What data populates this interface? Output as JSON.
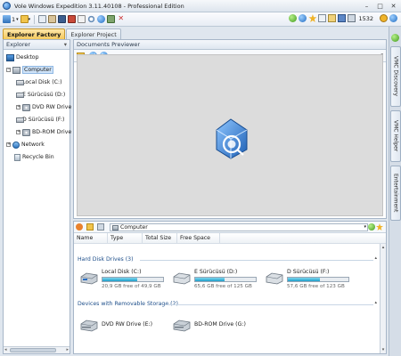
{
  "window": {
    "title": "Vole Windows Expedition  3.11.40108 - Professional Edition"
  },
  "toolbar": {
    "version_badge": "1",
    "counter": "1532"
  },
  "tabs": [
    {
      "label": "Explorer Factory",
      "active": true
    },
    {
      "label": "Explorer Project",
      "active": false
    }
  ],
  "explorer": {
    "title": "Explorer",
    "tree": [
      {
        "label": "Desktop",
        "icon": "desktop-icon"
      },
      {
        "label": "Computer",
        "icon": "computer-icon"
      },
      {
        "label": "Local Disk (C:)",
        "icon": "drive-icon"
      },
      {
        "label": "E Sürücüsü (D:)",
        "icon": "drive-icon"
      },
      {
        "label": "DVD RW Drive (E:)",
        "icon": "dvd-icon"
      },
      {
        "label": "D Sürücüsü (F:)",
        "icon": "drive-icon"
      },
      {
        "label": "BD-ROM Drive (G:)",
        "icon": "dvd-icon"
      },
      {
        "label": "Network",
        "icon": "network-icon"
      },
      {
        "label": "Recycle Bin",
        "icon": "recycle-bin-icon"
      }
    ]
  },
  "previewer": {
    "title": "Documents Previewer"
  },
  "browser": {
    "address": "Computer",
    "columns": [
      "Name",
      "Type",
      "Total Size",
      "Free Space"
    ],
    "hard_disk_group": "Hard Disk Drives (3)",
    "hard_disks": [
      {
        "name": "Local Disk (C:)",
        "free": "20,9 GB free of 49,9 GB",
        "used_fraction": 0.58
      },
      {
        "name": "E Sürücüsü (D:)",
        "free": "65,6 GB free of 125 GB",
        "used_fraction": 0.48
      },
      {
        "name": "D Sürücüsü (F:)",
        "free": "57,6 GB free of 123 GB",
        "used_fraction": 0.53
      }
    ],
    "removable_group": "Devices with Removable Storage (2)",
    "removable": [
      {
        "name": "DVD RW Drive (E:)"
      },
      {
        "name": "BD-ROM Drive (G:)"
      }
    ]
  },
  "right_rail": [
    {
      "label": "VMC Discovery"
    },
    {
      "label": "VMC Helper"
    },
    {
      "label": "Entertainment"
    }
  ],
  "colors": {
    "active_tab": "#f5c95d",
    "accent": "#2c79c8",
    "bar_fill": "#1e9ec9"
  }
}
